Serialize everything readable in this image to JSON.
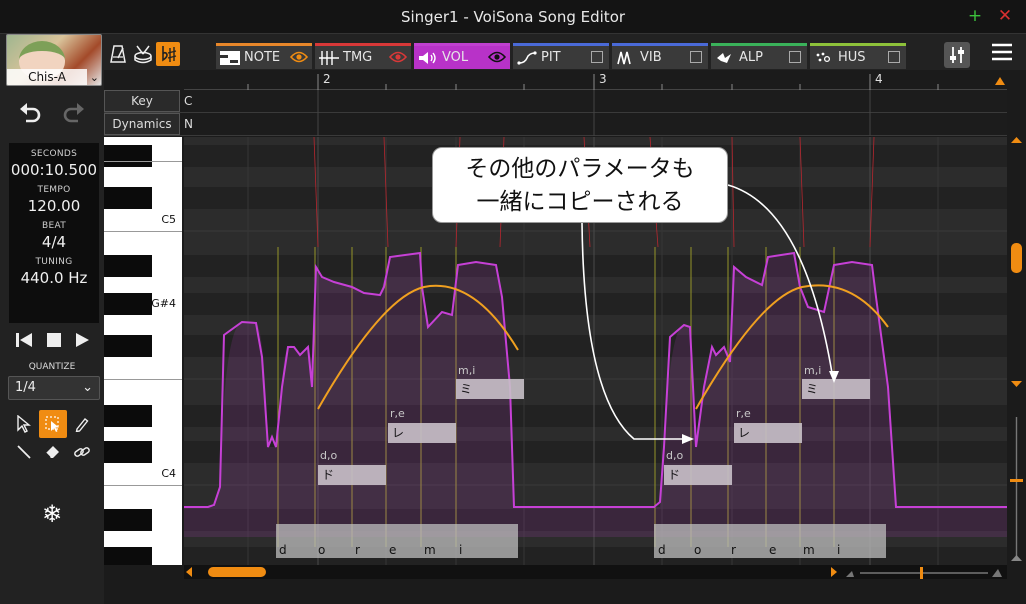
{
  "window": {
    "title": "Singer1 - VoiSona Song Editor",
    "add_glyph": "+",
    "close_glyph": "✕"
  },
  "singer": {
    "name": "Chis-A"
  },
  "toolbar": {
    "undo_icon": "undo-icon",
    "redo_icon": "redo-icon"
  },
  "info": {
    "seconds_label": "SECONDS",
    "seconds_value": "000:10.500",
    "tempo_label": "TEMPO",
    "tempo_value": "120.00",
    "beat_label": "BEAT",
    "beat_value": "4/4",
    "tuning_label": "TUNING",
    "tuning_value": "440.0 Hz"
  },
  "quantize": {
    "label": "QUANTIZE",
    "value": "1/4"
  },
  "tabs": [
    {
      "label": "NOTE",
      "color": "#e8872a"
    },
    {
      "label": "TMG",
      "color": "#d83838"
    },
    {
      "label": "VOL",
      "color": "#c040d0"
    },
    {
      "label": "PIT",
      "color": "#4a6ad8"
    },
    {
      "label": "VIB",
      "color": "#4a6ad8"
    },
    {
      "label": "ALP",
      "color": "#3ab25a"
    },
    {
      "label": "HUS",
      "color": "#8ec23a"
    }
  ],
  "ruler": {
    "measures": [
      "2",
      "3",
      "4"
    ]
  },
  "rows": {
    "key_label": "Key",
    "key_value": "C",
    "dynamics_label": "Dynamics",
    "dynamics_value": "N"
  },
  "piano": {
    "labels": [
      "C5",
      "G#4",
      "C4"
    ]
  },
  "notes": [
    {
      "phoneme": "d,o",
      "lyric": "ド"
    },
    {
      "phoneme": "r,e",
      "lyric": "レ"
    },
    {
      "phoneme": "m,i",
      "lyric": "ミ"
    },
    {
      "phoneme": "d,o",
      "lyric": "ド"
    },
    {
      "phoneme": "r,e",
      "lyric": "レ"
    },
    {
      "phoneme": "m,i",
      "lyric": "ミ"
    }
  ],
  "phonemes": [
    "d",
    "o",
    "r",
    "e",
    "m",
    "i",
    "d",
    "o",
    "r",
    "e",
    "m",
    "i"
  ],
  "callout": {
    "line1": "その他のパラメータも",
    "line2": "一緒にコピーされる"
  },
  "colors": {
    "accent": "#f08c12",
    "volume": "#c640d6",
    "pitch": "#f0a020"
  }
}
